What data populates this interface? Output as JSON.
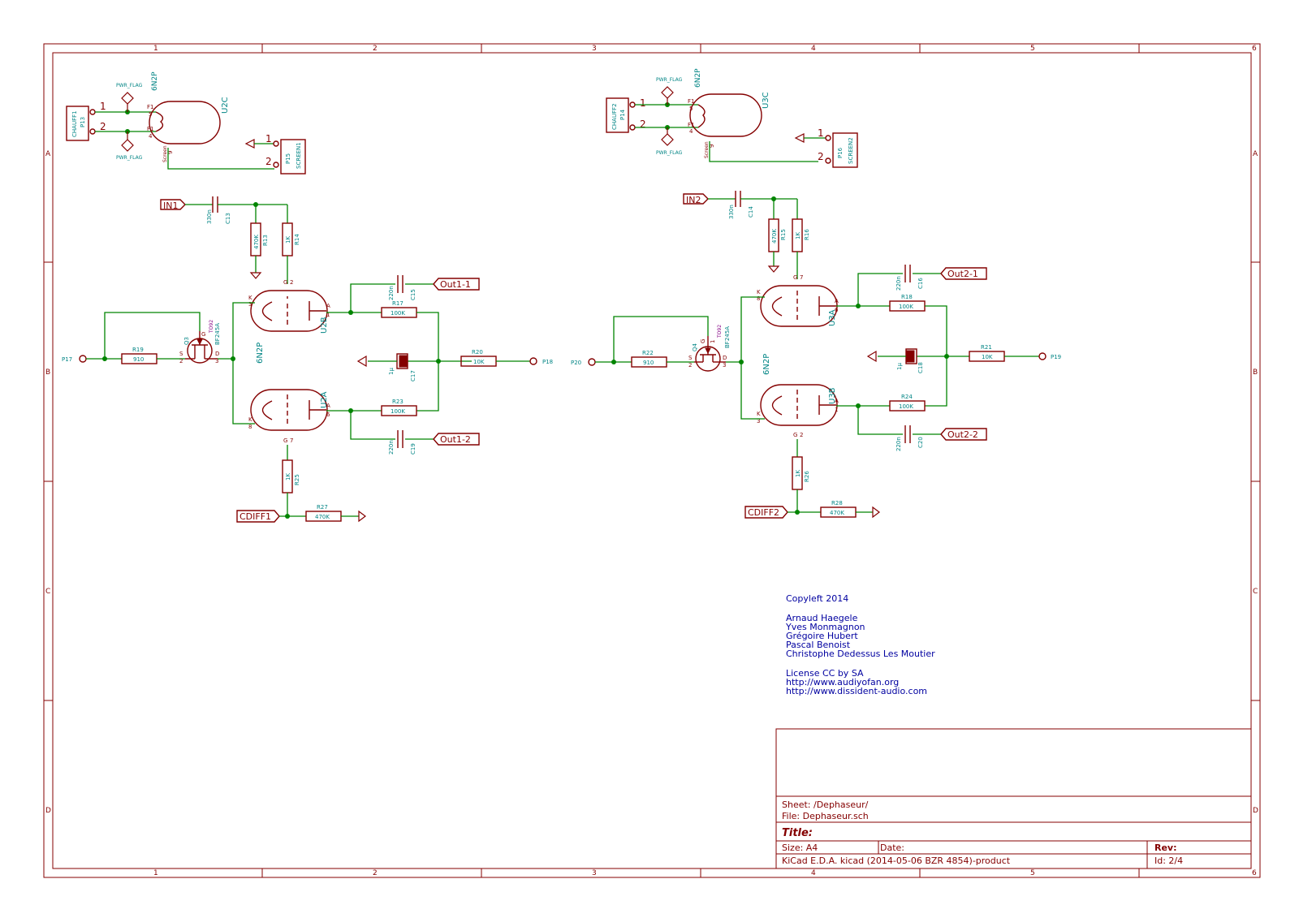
{
  "frame": {
    "columns": [
      "1",
      "2",
      "3",
      "4",
      "5",
      "6"
    ],
    "rows": [
      "A",
      "B",
      "C",
      "D"
    ]
  },
  "title_block": {
    "sheet": "Sheet: /Dephaseur/",
    "file": "File: Dephaseur.sch",
    "title": "Title:",
    "size": "Size: A4",
    "date": "Date:",
    "rev": "Rev:",
    "tool": "KiCad E.D.A.  kicad (2014-05-06 BZR 4854)-product",
    "id": "Id: 2/4"
  },
  "notes": {
    "copyleft": "Copyleft 2014",
    "authors": [
      "Arnaud Haegele",
      "Yves Monmagnon",
      "Grégoire Hubert",
      "Pascal Benoist",
      "Christophe Dedessus Les Moutier"
    ],
    "license": "License CC by SA",
    "links": [
      "http://www.audiyofan.org",
      "http://www.dissident-audio.com"
    ]
  },
  "left": {
    "heater": {
      "tube_ref": "U2C",
      "tube_val": "6N2P",
      "conn_ref": "P13",
      "conn_val": "CHAUFF1",
      "pin1": "1",
      "pin2": "2",
      "flag": "PWR_FLAG",
      "f_top": "F1",
      "f_bot": "F1",
      "pin5": "5",
      "pin4": "4",
      "screen": "Screen",
      "pin9": "9"
    },
    "screen": {
      "ref": "P15",
      "val": "SCREEN1",
      "pin1": "1",
      "pin2": "2"
    },
    "input": {
      "label": "IN1",
      "cap_ref": "C13",
      "cap_val": "330n"
    },
    "r13": {
      "ref": "R13",
      "val": "470K"
    },
    "r14": {
      "ref": "R14",
      "val": "1K"
    },
    "u2b": {
      "ref": "U2B",
      "val": "6N2P",
      "pin_k": "K",
      "pin_k_num": "3",
      "pin_g": "G",
      "pin_g_num": "2",
      "pin_a": "A",
      "pin_a_num": "1"
    },
    "u2a": {
      "ref": "U2A",
      "val": "6N2P",
      "pin_k": "K",
      "pin_k_num": "8",
      "pin_g": "G",
      "pin_g_num": "7",
      "pin_a": "A",
      "pin_a_num": "6"
    },
    "q3": {
      "ref": "Q3",
      "val": "BF245A",
      "pkg": "TO92",
      "pin_s": "S",
      "pin_s_num": "2",
      "pin_d": "D",
      "pin_d_num": "3",
      "pin_g": "G"
    },
    "r19": {
      "ref": "R19",
      "val": "910"
    },
    "p17": {
      "ref": "P17"
    },
    "c15": {
      "ref": "C15",
      "val": "220n"
    },
    "out1": {
      "label": "Out1-1"
    },
    "r17": {
      "ref": "R17",
      "val": "100K"
    },
    "c17": {
      "ref": "C17",
      "val": "1µ"
    },
    "r20": {
      "ref": "R20",
      "val": "10K"
    },
    "p18": {
      "ref": "P18"
    },
    "r23": {
      "ref": "R23",
      "val": "100K"
    },
    "c19": {
      "ref": "C19",
      "val": "220n"
    },
    "out2": {
      "label": "Out1-2"
    },
    "r25": {
      "ref": "R25",
      "val": "1K"
    },
    "cdiff": {
      "label": "CDIFF1"
    },
    "r27": {
      "ref": "R27",
      "val": "470K"
    }
  },
  "right": {
    "heater": {
      "tube_ref": "U3C",
      "tube_val": "6N2P",
      "conn_ref": "P14",
      "conn_val": "CHAUFF2",
      "pin1": "1",
      "pin2": "2",
      "flag": "PWR_FLAG",
      "f_top": "F1",
      "f_bot": "F1",
      "pin5": "5",
      "pin4": "4",
      "screen": "Screen",
      "pin9": "9"
    },
    "screen": {
      "ref": "P16",
      "val": "SCREEN2",
      "pin1": "1",
      "pin2": "2"
    },
    "input": {
      "label": "IN2",
      "cap_ref": "C14",
      "cap_val": "330n"
    },
    "r15": {
      "ref": "R15",
      "val": "470K"
    },
    "r16": {
      "ref": "R16",
      "val": "1K"
    },
    "u3a": {
      "ref": "U3A",
      "val": "6N2P",
      "pin_k": "K",
      "pin_k_num": "8",
      "pin_g": "G",
      "pin_g_num": "7",
      "pin_a": "A",
      "pin_a_num": "6"
    },
    "u3b": {
      "ref": "U3B",
      "val": "6N2P",
      "pin_k": "K",
      "pin_k_num": "3",
      "pin_g": "G",
      "pin_g_num": "2",
      "pin_a": "A",
      "pin_a_num": "1"
    },
    "q4": {
      "ref": "Q4",
      "val": "BF245A",
      "pkg": "TO92",
      "pin_s": "S",
      "pin_s_num": "2",
      "pin_d": "D",
      "pin_d_num": "3",
      "pin_g": "G",
      "pin_g_num": "1"
    },
    "r22": {
      "ref": "R22",
      "val": "910"
    },
    "p20": {
      "ref": "P20"
    },
    "c16": {
      "ref": "C16",
      "val": "220n"
    },
    "out1": {
      "label": "Out2-1"
    },
    "r18": {
      "ref": "R18",
      "val": "100K"
    },
    "c18": {
      "ref": "C18",
      "val": "1µ"
    },
    "r21": {
      "ref": "R21",
      "val": "10K"
    },
    "p19": {
      "ref": "P19"
    },
    "r24": {
      "ref": "R24",
      "val": "100K"
    },
    "c20": {
      "ref": "C20",
      "val": "220n"
    },
    "out2": {
      "label": "Out2-2"
    },
    "r26": {
      "ref": "R26",
      "val": "1K"
    },
    "cdiff": {
      "label": "CDIFF2"
    },
    "r28": {
      "ref": "R28",
      "val": "470K"
    }
  }
}
